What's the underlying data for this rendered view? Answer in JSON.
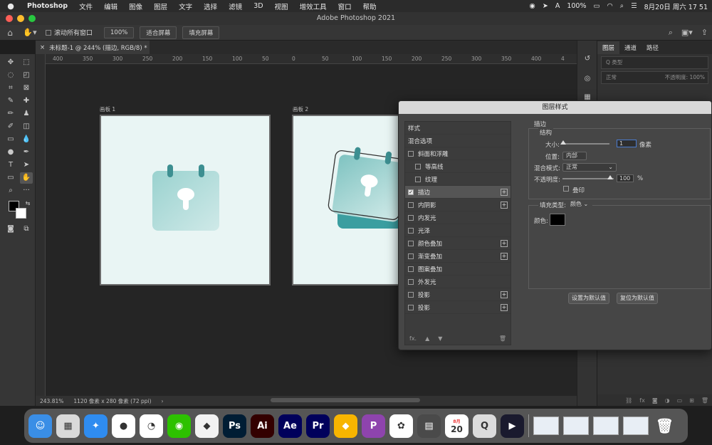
{
  "menubar": {
    "apple": "",
    "items": [
      "Photoshop",
      "文件",
      "编辑",
      "图像",
      "图层",
      "文字",
      "选择",
      "滤镜",
      "3D",
      "视图",
      "增效工具",
      "窗口",
      "帮助"
    ],
    "battery": "100%",
    "datetime": "8月20日 周六 17 51"
  },
  "window": {
    "title": "Adobe Photoshop 2021"
  },
  "options": {
    "scroll_all_label": "滚动所有窗口",
    "zoom_100": "100%",
    "fit_screen": "适合屏幕",
    "fill_screen": "填充屏幕"
  },
  "document": {
    "tab_title": "未标题-1 @ 244% (描边, RGB/8) *",
    "close": "×"
  },
  "ruler": {
    "ticks": [
      "400",
      "350",
      "300",
      "250",
      "200",
      "150",
      "100",
      "50",
      "0",
      "50",
      "100",
      "150",
      "200",
      "250",
      "300",
      "350",
      "400",
      "4"
    ]
  },
  "canvas": {
    "artboard1_label": "画板 1",
    "artboard2_label": "画板 2"
  },
  "status": {
    "zoom": "243.81%",
    "size": "1120 像素 x 280 像素 (72 ppi)",
    "arrow": "›"
  },
  "layers_panel": {
    "tabs": [
      "图层",
      "通道",
      "路径"
    ],
    "kind_label": "Q 类型",
    "blend_mode": "正常",
    "opacity_label": "不透明度:",
    "opacity_value": "100%"
  },
  "dialog": {
    "title": "图层样式",
    "list": [
      {
        "label": "样式",
        "type": "head"
      },
      {
        "label": "混合选项",
        "type": "head"
      },
      {
        "label": "斜面和浮雕",
        "checked": false
      },
      {
        "label": "等高线",
        "checked": false,
        "sub": true
      },
      {
        "label": "纹理",
        "checked": false,
        "sub": true
      },
      {
        "label": "描边",
        "checked": true,
        "selected": true,
        "plus": true
      },
      {
        "label": "内阴影",
        "checked": false,
        "plus": true
      },
      {
        "label": "内发光",
        "checked": false
      },
      {
        "label": "光泽",
        "checked": false
      },
      {
        "label": "颜色叠加",
        "checked": false,
        "plus": true
      },
      {
        "label": "渐变叠加",
        "checked": false,
        "plus": true
      },
      {
        "label": "图案叠加",
        "checked": false
      },
      {
        "label": "外发光",
        "checked": false
      },
      {
        "label": "投影",
        "checked": false,
        "plus": true
      },
      {
        "label": "投影",
        "checked": false,
        "plus": true
      }
    ],
    "footer_fx": "fx.",
    "stroke": {
      "section": "描边",
      "structure": "结构",
      "size_label": "大小:",
      "size_value": "1",
      "size_unit": "像素",
      "position_label": "位置:",
      "position_value": "内部",
      "blend_label": "混合模式:",
      "blend_value": "正常",
      "opacity_label": "不透明度:",
      "opacity_value": "100",
      "opacity_unit": "%",
      "overprint_label": "叠印",
      "fill_type_label": "填充类型:",
      "fill_type_value": "颜色",
      "color_label": "颜色:",
      "color_value": "#000000"
    },
    "set_default": "设置为默认值",
    "reset_default": "复位为默认值"
  },
  "dock": {
    "apps": [
      {
        "name": "finder",
        "text": "☺",
        "bg": "#3a8ee6"
      },
      {
        "name": "launchpad",
        "text": "▦",
        "bg": "#d9d9d9"
      },
      {
        "name": "safari",
        "text": "✦",
        "bg": "#2f8cf0"
      },
      {
        "name": "qq",
        "text": "●",
        "bg": "#ffffff"
      },
      {
        "name": "dingtalk",
        "text": "◔",
        "bg": "#ffffff"
      },
      {
        "name": "wechat",
        "text": "◉",
        "bg": "#2dc100"
      },
      {
        "name": "tree",
        "text": "◆",
        "bg": "#f2f2f2"
      },
      {
        "name": "photoshop",
        "text": "Ps",
        "bg": "#001d34"
      },
      {
        "name": "illustrator",
        "text": "Ai",
        "bg": "#330000"
      },
      {
        "name": "after-effects",
        "text": "Ae",
        "bg": "#00005b"
      },
      {
        "name": "premiere",
        "text": "Pr",
        "bg": "#00005b"
      },
      {
        "name": "sketch",
        "text": "◆",
        "bg": "#f7b500"
      },
      {
        "name": "pockity",
        "text": "P",
        "bg": "#8e44ad"
      },
      {
        "name": "figma",
        "text": "✿",
        "bg": "#ffffff"
      },
      {
        "name": "calculator",
        "text": "▤",
        "bg": "#4a4a4a"
      },
      {
        "name": "calendar",
        "text": "20",
        "bg": "#ffffff"
      },
      {
        "name": "quicktime",
        "text": "Q",
        "bg": "#dcdcdc"
      },
      {
        "name": "screen-app",
        "text": "▶",
        "bg": "#1a1a2e"
      }
    ],
    "calendar_month": "8月",
    "trash": "🗑"
  }
}
